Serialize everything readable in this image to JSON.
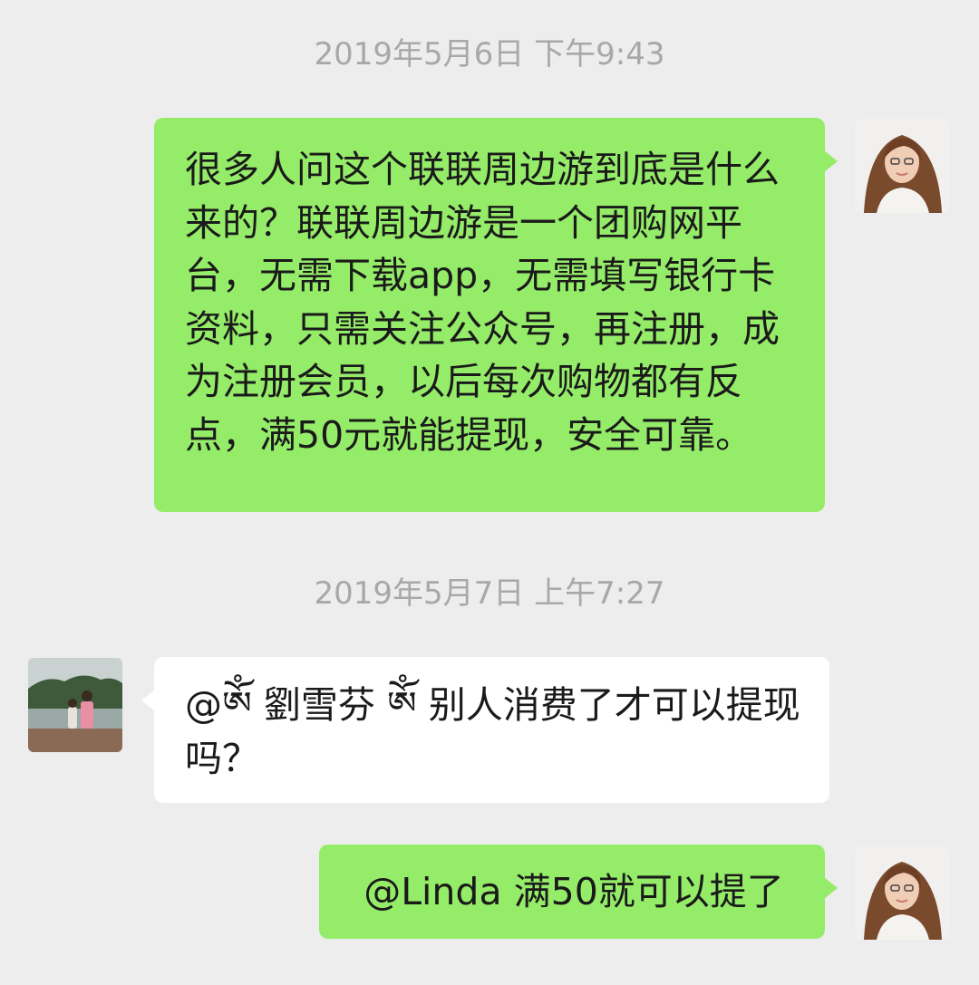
{
  "timestamps": {
    "first": "2019年5月6日 下午9:43",
    "second": "2019年5月7日 上午7:27"
  },
  "messages": {
    "self_long": "很多人问这个联联周边游到底是什么来的？联联周边游是一个团购网平台，无需下载app，无需填写银行卡资料，只需关注公众号，再注册，成为注册会员，以后每次购物都有反点，满50元就能提现，安全可靠。",
    "linda_question": {
      "mention": "@ༀ 劉雪芬 ༀ",
      "text": "别人消费了才可以提现吗？"
    },
    "self_reply": "@Linda 满50就可以提了"
  },
  "colors": {
    "background": "#ededed",
    "self_bubble": "#95ec69",
    "other_bubble": "#ffffff",
    "timestamp": "#a8a8a8"
  },
  "icons": {
    "self_avatar": "woman-portrait-avatar",
    "other_avatar": "lakeside-photo-avatar"
  }
}
